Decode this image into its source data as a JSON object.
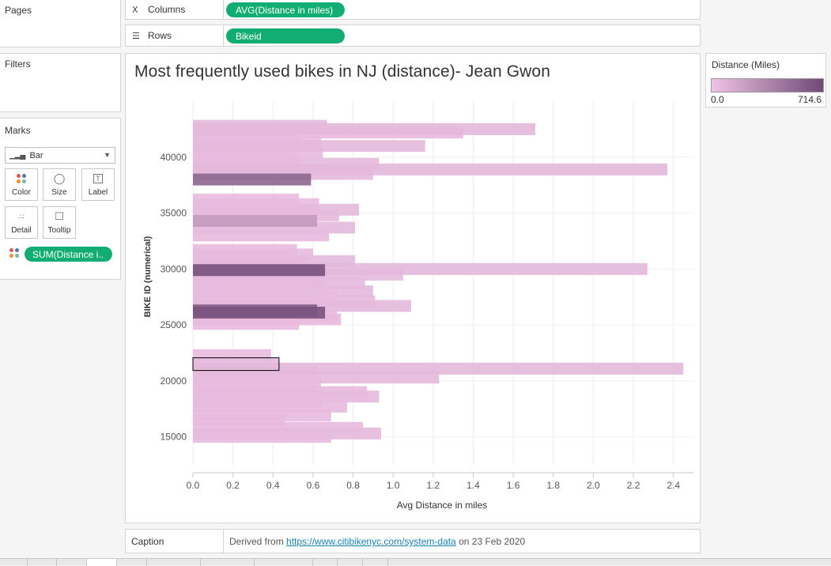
{
  "shelves": {
    "pages_label": "Pages",
    "filters_label": "Filters",
    "columns": {
      "label": "Columns",
      "pill": "AVG(Distance in miles)"
    },
    "rows": {
      "label": "Rows",
      "pill": "Bikeid"
    }
  },
  "marks": {
    "title": "Marks",
    "type": "Bar",
    "buttons": [
      "Color",
      "Size",
      "Label",
      "Detail",
      "Tooltip"
    ],
    "pill": "SUM(Distance i.."
  },
  "legend": {
    "title": "Distance (Miles)",
    "min": "0.0",
    "max": "714.6",
    "colors": [
      "#efc3e4",
      "#6f4a76"
    ]
  },
  "caption": {
    "label": "Caption",
    "prefix": "Derived from ",
    "link": "https://www.citibikenyc.com/system-data",
    "suffix": " on 23 Feb 2020"
  },
  "chart_data": {
    "type": "bar",
    "orientation": "horizontal",
    "title": "Most frequently used bikes in NJ (distance)- Jean Gwon",
    "xlabel": "Avg Distance in miles",
    "ylabel": "BIKE ID (numerical)",
    "xlim": [
      0,
      2.5
    ],
    "ylim": [
      12500,
      45000
    ],
    "x_ticks": [
      "0.0",
      "0.2",
      "0.4",
      "0.6",
      "0.8",
      "1.0",
      "1.2",
      "1.4",
      "1.6",
      "1.8",
      "2.0",
      "2.2",
      "2.4"
    ],
    "y_ticks": [
      "40000",
      "35000",
      "30000",
      "25000",
      "20000",
      "15000"
    ],
    "grid": "vertical",
    "bars": [
      {
        "bikeid": 42800,
        "avg": 0.67,
        "sum": 55
      },
      {
        "bikeid": 42500,
        "avg": 1.71,
        "sum": 60
      },
      {
        "bikeid": 42200,
        "avg": 1.35,
        "sum": 45
      },
      {
        "bikeid": 41900,
        "avg": 0.53,
        "sum": 40
      },
      {
        "bikeid": 41300,
        "avg": 0.64,
        "sum": 35
      },
      {
        "bikeid": 41000,
        "avg": 1.16,
        "sum": 55
      },
      {
        "bikeid": 40700,
        "avg": 0.51,
        "sum": 30
      },
      {
        "bikeid": 40400,
        "avg": 0.65,
        "sum": 40
      },
      {
        "bikeid": 39700,
        "avg": 0.53,
        "sum": 45
      },
      {
        "bikeid": 39400,
        "avg": 0.93,
        "sum": 50
      },
      {
        "bikeid": 38900,
        "avg": 2.37,
        "sum": 60
      },
      {
        "bikeid": 38500,
        "avg": 0.9,
        "sum": 50
      },
      {
        "bikeid": 38000,
        "avg": 0.59,
        "sum": 540
      },
      {
        "bikeid": 36200,
        "avg": 0.53,
        "sum": 40
      },
      {
        "bikeid": 35800,
        "avg": 0.63,
        "sum": 35
      },
      {
        "bikeid": 35300,
        "avg": 0.83,
        "sum": 50
      },
      {
        "bikeid": 34800,
        "avg": 0.73,
        "sum": 45
      },
      {
        "bikeid": 34300,
        "avg": 0.62,
        "sum": 240
      },
      {
        "bikeid": 33700,
        "avg": 0.81,
        "sum": 50
      },
      {
        "bikeid": 33000,
        "avg": 0.68,
        "sum": 45
      },
      {
        "bikeid": 31700,
        "avg": 0.52,
        "sum": 40
      },
      {
        "bikeid": 31300,
        "avg": 0.6,
        "sum": 45
      },
      {
        "bikeid": 30700,
        "avg": 0.81,
        "sum": 50
      },
      {
        "bikeid": 30500,
        "avg": 0.58,
        "sum": 40
      },
      {
        "bikeid": 30000,
        "avg": 2.27,
        "sum": 60
      },
      {
        "bikeid": 29900,
        "avg": 0.66,
        "sum": 660
      },
      {
        "bikeid": 29500,
        "avg": 1.05,
        "sum": 45
      },
      {
        "bikeid": 29000,
        "avg": 0.66,
        "sum": 40
      },
      {
        "bikeid": 28700,
        "avg": 0.86,
        "sum": 50
      },
      {
        "bikeid": 28400,
        "avg": 0.56,
        "sum": 35
      },
      {
        "bikeid": 28000,
        "avg": 0.9,
        "sum": 50
      },
      {
        "bikeid": 27500,
        "avg": 0.72,
        "sum": 40
      },
      {
        "bikeid": 27100,
        "avg": 0.91,
        "sum": 50
      },
      {
        "bikeid": 26700,
        "avg": 1.09,
        "sum": 55
      },
      {
        "bikeid": 26300,
        "avg": 0.62,
        "sum": 600
      },
      {
        "bikeid": 26100,
        "avg": 0.66,
        "sum": 650
      },
      {
        "bikeid": 25800,
        "avg": 0.72,
        "sum": 40
      },
      {
        "bikeid": 25500,
        "avg": 0.74,
        "sum": 45
      },
      {
        "bikeid": 25100,
        "avg": 0.53,
        "sum": 40
      },
      {
        "bikeid": 22300,
        "avg": 0.39,
        "sum": 35
      },
      {
        "bikeid": 21500,
        "avg": 0.43,
        "sum": 50
      },
      {
        "bikeid": 21100,
        "avg": 2.45,
        "sum": 60
      },
      {
        "bikeid": 20700,
        "avg": 0.62,
        "sum": 40
      },
      {
        "bikeid": 20300,
        "avg": 1.23,
        "sum": 50
      },
      {
        "bikeid": 19900,
        "avg": 0.64,
        "sum": 40
      },
      {
        "bikeid": 19400,
        "avg": 0.62,
        "sum": 35
      },
      {
        "bikeid": 19000,
        "avg": 0.87,
        "sum": 45
      },
      {
        "bikeid": 18600,
        "avg": 0.93,
        "sum": 50
      },
      {
        "bikeid": 18100,
        "avg": 0.65,
        "sum": 40
      },
      {
        "bikeid": 17700,
        "avg": 0.77,
        "sum": 45
      },
      {
        "bikeid": 16900,
        "avg": 0.69,
        "sum": 40
      },
      {
        "bikeid": 16500,
        "avg": 0.46,
        "sum": 30
      },
      {
        "bikeid": 15800,
        "avg": 0.85,
        "sum": 45
      },
      {
        "bikeid": 15300,
        "avg": 0.94,
        "sum": 50
      },
      {
        "bikeid": 15000,
        "avg": 0.69,
        "sum": 40
      }
    ],
    "selected_bikeid": 21500
  }
}
